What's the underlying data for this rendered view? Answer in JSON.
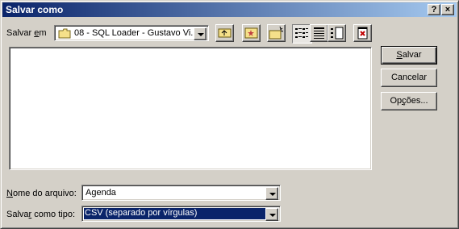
{
  "window": {
    "title": "Salvar como",
    "help_label": "?",
    "close_label": "×"
  },
  "location": {
    "label_pre": "Salvar ",
    "label_key": "e",
    "label_post": "m",
    "value": "08 - SQL Loader - Gustavo Vi..."
  },
  "toolbar": {
    "icons": [
      "up-folder-icon",
      "desktop-icon",
      "new-folder-icon",
      "list-view-icon",
      "details-view-icon",
      "properties-view-icon",
      "tools-icon"
    ]
  },
  "buttons": {
    "save": {
      "key": "S",
      "rest": "alvar"
    },
    "cancel": "Cancelar",
    "options": {
      "pre": "Op",
      "key": "ç",
      "post": "ões..."
    }
  },
  "filename": {
    "label_key": "N",
    "label_rest": "ome do arquivo:",
    "value": "Agenda"
  },
  "filetype": {
    "label_pre": "Salva",
    "label_key": "r",
    "label_post": " como tipo:",
    "value": "CSV (separado por vírgulas)"
  },
  "colors": {
    "title_start": "#0a246a",
    "title_end": "#a6caf0",
    "face": "#d4d0c8",
    "select_bg": "#0a246a"
  }
}
